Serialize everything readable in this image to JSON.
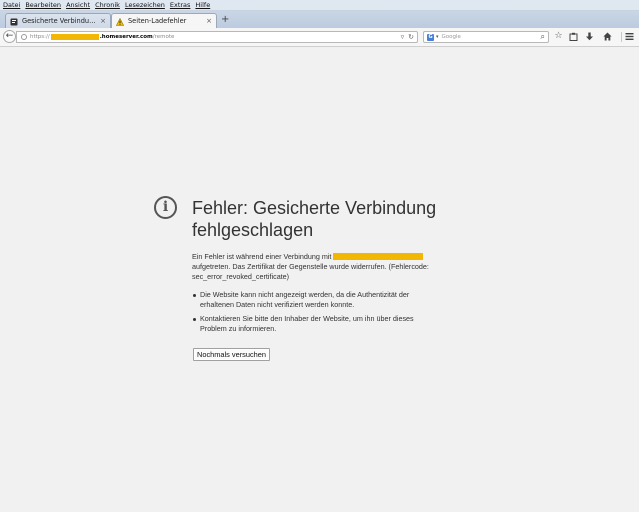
{
  "menu": {
    "items": [
      "Datei",
      "Bearbeiten",
      "Ansicht",
      "Chronik",
      "Lesezeichen",
      "Extras",
      "Hilfe"
    ]
  },
  "tabs": [
    {
      "label": "Gesicherte Verbindung fehl...",
      "active": false,
      "close": "×"
    },
    {
      "label": "Seiten-Ladefehler",
      "active": true,
      "close": "×"
    }
  ],
  "new_tab_label": "+",
  "urlbar": {
    "scheme": "https://",
    "domain": ".homeserver.com",
    "path": "/remote"
  },
  "searchbar": {
    "placeholder": "Google",
    "engine_icon": "G"
  },
  "toolbar_icons": [
    "back-icon",
    "reload-icon",
    "bookmark-star-icon",
    "clipboard-icon",
    "download-icon",
    "home-icon",
    "menu-icon"
  ],
  "error": {
    "icon": "i",
    "title": "Fehler: Gesicherte Verbindung fehlgeschlagen",
    "text_before": "Ein Fehler ist während einer Verbindung mit ",
    "text_after": " aufgetreten. Das Zertifikat der Gegenstelle wurde widerrufen. (Fehlercode: sec_error_revoked_certificate)",
    "bullets": [
      "Die Website kann nicht angezeigt werden, da die Authentizität der erhaltenen Daten nicht verifiziert werden konnte.",
      "Kontaktieren Sie bitte den Inhaber der Website, um ihn über dieses Problem zu informieren."
    ],
    "retry_label": "Nochmals versuchen"
  },
  "colors": {
    "page_bg": "#f1f1f1",
    "redaction": "#f2b705",
    "tabbar": "#c9d6e6"
  }
}
